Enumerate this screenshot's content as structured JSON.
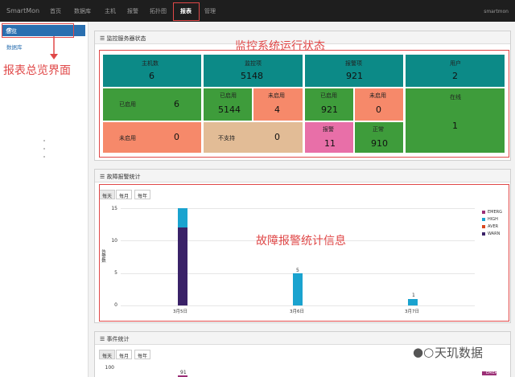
{
  "topbar": {
    "brand": "SmartMon",
    "nav": [
      "首页",
      "数据库",
      "主机",
      "报警",
      "拓扑图",
      "报表",
      "管理"
    ],
    "active_index": 5,
    "user": "smartmon"
  },
  "sidebar": {
    "active_label": "总览",
    "items": [
      "数据库"
    ]
  },
  "annotations": {
    "report_overview": "报表总览界面",
    "monitor_status": "监控系统运行状态",
    "fault_stats": "故障报警统计信息"
  },
  "status_panel": {
    "title": "监控服务器状态",
    "hosts": {
      "label": "主机数",
      "value": "6",
      "enabled_label": "已启用",
      "enabled": "6",
      "disabled_label": "未启用",
      "disabled": "0"
    },
    "items": {
      "label": "监控项",
      "value": "5148",
      "enabled_label": "已启用",
      "enabled": "5144",
      "disabled_label": "未启用",
      "disabled": "4",
      "unsupported_label": "不支持",
      "unsupported": "0"
    },
    "triggers": {
      "label": "报警项",
      "value": "921",
      "enabled_label": "已启用",
      "enabled": "921",
      "disabled_label": "未启用",
      "disabled": "0",
      "alarm_label": "报警",
      "alarm": "11",
      "normal_label": "正常",
      "normal": "910"
    },
    "users": {
      "label": "用户",
      "value": "2",
      "online_label": "在线",
      "online": "1"
    }
  },
  "alarm_panel": {
    "title": "故障报警统计",
    "tabs": [
      "每天",
      "每月",
      "每年"
    ],
    "ylabel": "告警数"
  },
  "event_panel": {
    "title": "事件统计",
    "tabs": [
      "每天",
      "每月",
      "每年"
    ],
    "ytick": "100",
    "bar_label": "91"
  },
  "colors": {
    "teal": "#0c8a87",
    "green": "#3e9c3b",
    "salmon": "#f6896a",
    "tan": "#e2bc96",
    "pink": "#e86fa8",
    "red": "#e04848",
    "nav_blue": "#2a6fb0"
  },
  "chart_data": {
    "type": "bar",
    "categories": [
      "3月5日",
      "3月6日",
      "3月7日"
    ],
    "series": [
      {
        "name": "EMERG",
        "values": [
          0,
          0,
          0
        ],
        "color": "#9b2f76"
      },
      {
        "name": "HIGH",
        "values": [
          3,
          5,
          1
        ],
        "color": "#1aa3cf"
      },
      {
        "name": "AVER",
        "values": [
          0,
          0,
          0
        ],
        "color": "#d9481f"
      },
      {
        "name": "WARN",
        "values": [
          12,
          0,
          0
        ],
        "color": "#3a2268"
      }
    ],
    "bar_labels": [
      "",
      "5",
      "1"
    ],
    "ylabel": "告警数",
    "ylim": [
      0,
      15
    ],
    "yticks": [
      0,
      5,
      10,
      15
    ],
    "legend": "right"
  },
  "watermark": "天玑数据"
}
